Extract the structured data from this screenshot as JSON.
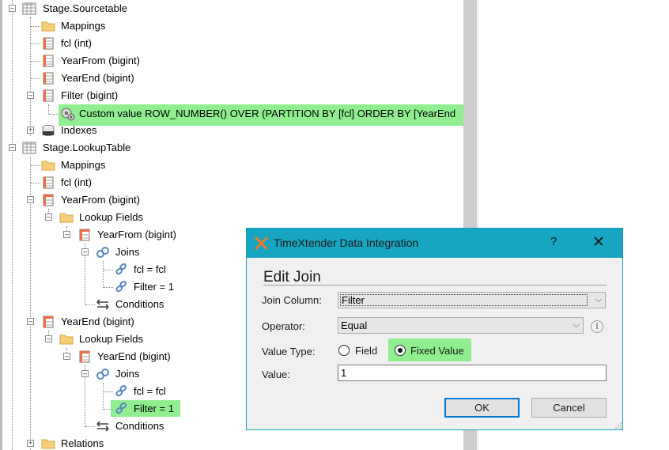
{
  "tree": {
    "items": [
      {
        "label": "Stage.Sourcetable",
        "icon": "table-icon"
      },
      {
        "label": "Mappings",
        "icon": "folder-icon"
      },
      {
        "label": "fcl (int)",
        "icon": "field-icon"
      },
      {
        "label": "YearFrom (bigint)",
        "icon": "field-icon"
      },
      {
        "label": "YearEnd (bigint)",
        "icon": "field-icon"
      },
      {
        "label": "Filter (bigint)",
        "icon": "field-icon"
      },
      {
        "label": "Custom value ROW_NUMBER() OVER (PARTITION BY [fcl] ORDER BY [YearEnd",
        "icon": "custom-value-icon"
      },
      {
        "label": "Indexes",
        "icon": "indexes-icon"
      },
      {
        "label": "Stage.LookupTable",
        "icon": "table-icon"
      },
      {
        "label": "Mappings",
        "icon": "folder-icon"
      },
      {
        "label": "fcl (int)",
        "icon": "field-icon"
      },
      {
        "label": "YearFrom (bigint)",
        "icon": "lookup-field-icon"
      },
      {
        "label": "Lookup Fields",
        "icon": "folder-icon"
      },
      {
        "label": "YearFrom (bigint)",
        "icon": "lookup-field-icon"
      },
      {
        "label": "Joins",
        "icon": "joins-icon"
      },
      {
        "label": "fcl = fcl",
        "icon": "join-icon"
      },
      {
        "label": "Filter = 1",
        "icon": "join-icon"
      },
      {
        "label": "Conditions",
        "icon": "conditions-icon"
      },
      {
        "label": "YearEnd (bigint)",
        "icon": "lookup-field-icon"
      },
      {
        "label": "Lookup Fields",
        "icon": "folder-icon"
      },
      {
        "label": "YearEnd (bigint)",
        "icon": "lookup-field-icon"
      },
      {
        "label": "Joins",
        "icon": "joins-icon"
      },
      {
        "label": "fcl = fcl",
        "icon": "join-icon"
      },
      {
        "label": "Filter = 1",
        "icon": "join-icon"
      },
      {
        "label": "Conditions",
        "icon": "conditions-icon"
      },
      {
        "label": "Relations",
        "icon": "folder-icon"
      }
    ]
  },
  "dialog": {
    "title": "TimeXtender Data Integration",
    "help": "?",
    "close": "✕",
    "heading": "Edit Join",
    "join_column_label": "Join Column:",
    "join_column_value": "Filter",
    "operator_label": "Operator:",
    "operator_value": "Equal",
    "value_type_label": "Value Type:",
    "radio_field_label": "Field",
    "radio_fixed_label": "Fixed Value",
    "value_label": "Value:",
    "value_input": "1",
    "ok_label": "OK",
    "cancel_label": "Cancel"
  },
  "colors": {
    "highlight": "#90ee90",
    "titlebar": "#17a5c1",
    "logo": "#f07b22"
  }
}
